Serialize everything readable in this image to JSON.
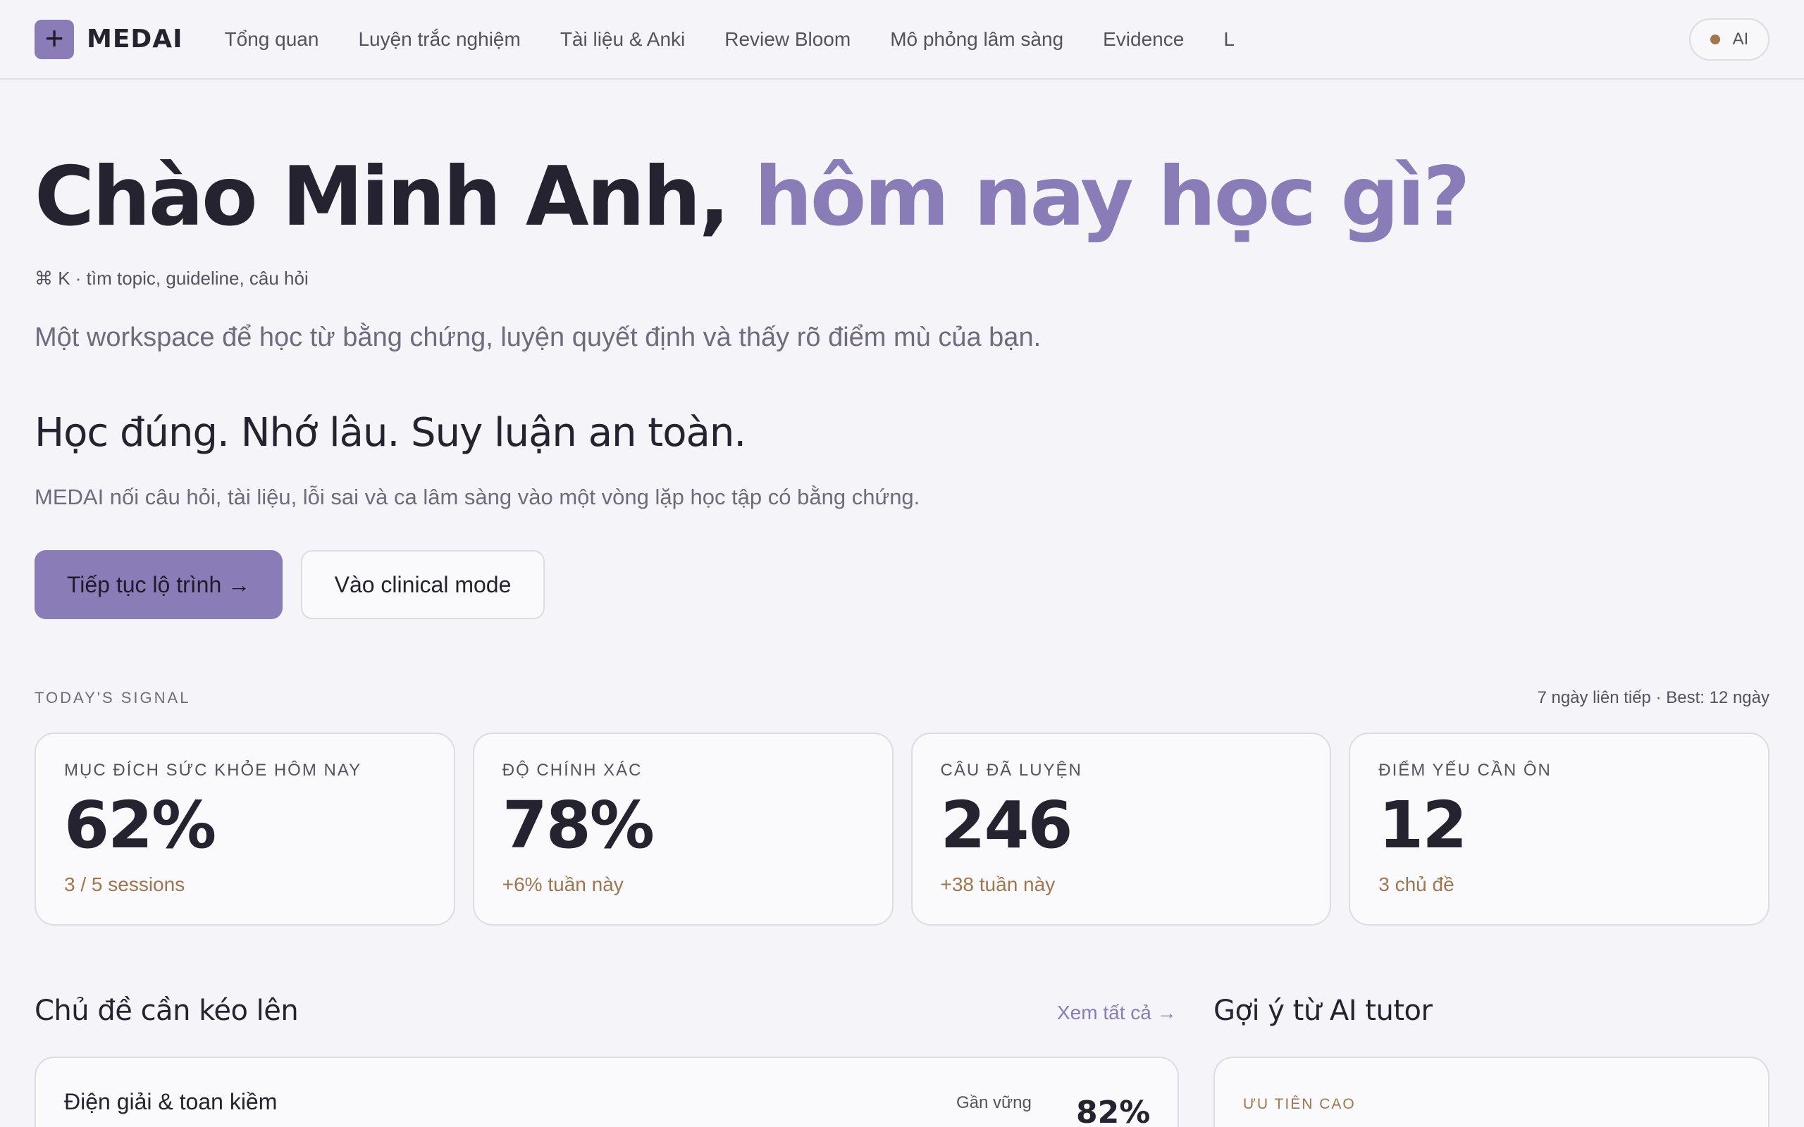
{
  "nav": {
    "logo_mark": "+",
    "logo_text": "MEDAI",
    "links": [
      "Tổng quan",
      "Luyện trắc nghiệm",
      "Tài liệu & Anki",
      "Review Bloom",
      "Mô phỏng lâm sàng",
      "Evidence",
      "L"
    ],
    "ai_label": "AI"
  },
  "hero": {
    "title_main": "Chào Minh Anh,",
    "title_accent": "hôm nay học gì?",
    "shortcut": "⌘ K · tìm topic, guideline, câu hỏi",
    "lead": "Một workspace để học từ bằng chứng, luyện quyết định và thấy rõ điểm mù của bạn.",
    "tagline": "Học đúng. Nhớ lâu. Suy luận an toàn.",
    "sub": "MEDAI nối câu hỏi, tài liệu, lỗi sai và ca lâm sàng vào một vòng lặp học tập có bằng chứng.",
    "primary_button": "Tiếp tục lộ trình →",
    "secondary_button": "Vào clinical mode"
  },
  "signal": {
    "label": "TODAY'S SIGNAL",
    "streak": "7 ngày liên tiếp · Best: 12 ngày",
    "cards": [
      {
        "label": "MỤC ĐÍCH SỨC KHỎE HÔM NAY",
        "value": "62%",
        "note": "3 / 5 sessions"
      },
      {
        "label": "ĐỘ CHÍNH XÁC",
        "value": "78%",
        "note": "+6% tuần này"
      },
      {
        "label": "CÂU ĐÃ LUYỆN",
        "value": "246",
        "note": "+38 tuần này"
      },
      {
        "label": "ĐIỂM YẾU CẦN ÔN",
        "value": "12",
        "note": "3 chủ đề"
      }
    ]
  },
  "topics": {
    "title": "Chủ đề cần kéo lên",
    "see_all": "Xem tất cả →",
    "items": [
      {
        "name": "Điện giải & toan kiềm",
        "status": "Gần vững",
        "pct": "82%"
      }
    ]
  },
  "ai_tutor": {
    "title": "Gợi ý từ AI tutor",
    "priority": "ƯU TIÊN CAO"
  },
  "colors": {
    "accent": "#8a7cb6",
    "warm": "#a0764d",
    "background": "#f5f4f8"
  }
}
